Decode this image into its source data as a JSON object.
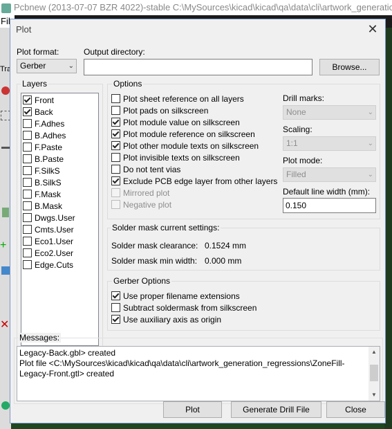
{
  "parent": {
    "title": "Pcbnew (2013-07-07 BZR 4022)-stable C:\\MySources\\kicad\\kicad\\qa\\data\\cli\\artwork_generation_regressions\\",
    "menu_file": "File",
    "tab_partial": "Tra"
  },
  "dialog": {
    "title": "Plot",
    "plot_format_label": "Plot format:",
    "plot_format_value": "Gerber",
    "output_dir_label": "Output directory:",
    "output_dir_value": "",
    "browse_label": "Browse...",
    "layers_title": "Layers",
    "layers": [
      {
        "name": "Front",
        "checked": true
      },
      {
        "name": "Back",
        "checked": true
      },
      {
        "name": "F.Adhes",
        "checked": false
      },
      {
        "name": "B.Adhes",
        "checked": false
      },
      {
        "name": "F.Paste",
        "checked": false
      },
      {
        "name": "B.Paste",
        "checked": false
      },
      {
        "name": "F.SilkS",
        "checked": false
      },
      {
        "name": "B.SilkS",
        "checked": false
      },
      {
        "name": "F.Mask",
        "checked": false
      },
      {
        "name": "B.Mask",
        "checked": false
      },
      {
        "name": "Dwgs.User",
        "checked": false
      },
      {
        "name": "Cmts.User",
        "checked": false
      },
      {
        "name": "Eco1.User",
        "checked": false
      },
      {
        "name": "Eco2.User",
        "checked": false
      },
      {
        "name": "Edge.Cuts",
        "checked": false
      }
    ],
    "options_title": "Options",
    "options": [
      {
        "label": "Plot sheet reference on all layers",
        "checked": false,
        "disabled": false
      },
      {
        "label": "Plot pads on silkscreen",
        "checked": false,
        "disabled": false
      },
      {
        "label": "Plot module value on silkscreen",
        "checked": true,
        "disabled": false
      },
      {
        "label": "Plot module reference on silkscreen",
        "checked": true,
        "disabled": false
      },
      {
        "label": "Plot other module texts on silkscreen",
        "checked": true,
        "disabled": false
      },
      {
        "label": "Plot invisible texts on silkscreen",
        "checked": false,
        "disabled": false
      },
      {
        "label": "Do not tent vias",
        "checked": false,
        "disabled": false
      },
      {
        "label": "Exclude PCB edge layer from other layers",
        "checked": true,
        "disabled": false
      },
      {
        "label": "Mirrored plot",
        "checked": false,
        "disabled": true
      },
      {
        "label": "Negative plot",
        "checked": false,
        "disabled": true
      }
    ],
    "drill_marks_label": "Drill marks:",
    "drill_marks_value": "None",
    "scaling_label": "Scaling:",
    "scaling_value": "1:1",
    "plot_mode_label": "Plot mode:",
    "plot_mode_value": "Filled",
    "line_width_label": "Default line width (mm):",
    "line_width_value": "0.150",
    "solder_title": "Solder mask current settings:",
    "solder_clearance_label": "Solder mask clearance:",
    "solder_clearance_value": "0.1524 mm",
    "solder_minwidth_label": "Solder mask min width:",
    "solder_minwidth_value": "0.000 mm",
    "gerber_title": "Gerber Options",
    "gerber_options": [
      {
        "label": "Use proper filename extensions",
        "checked": true
      },
      {
        "label": "Subtract soldermask from silkscreen",
        "checked": false
      },
      {
        "label": "Use auxiliary axis as origin",
        "checked": true
      }
    ],
    "messages_title": "Messages:",
    "messages_text": "Legacy-Back.gbl> created\nPlot file <C:\\MySources\\kicad\\kicad\\qa\\data\\cli\\artwork_generation_regressions\\ZoneFill-\nLegacy-Front.gtl> created",
    "plot_button": "Plot",
    "drill_button": "Generate Drill File",
    "close_button": "Close"
  }
}
